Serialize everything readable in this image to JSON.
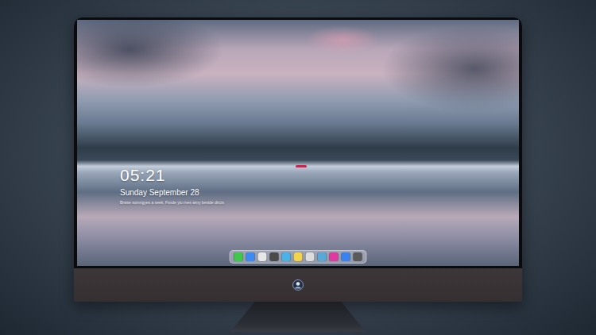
{
  "lock_screen": {
    "time": "05:21",
    "date": "Sunday September 28",
    "note": "Brwse somngyes a seek. Fsnde yiu rnes wmy beside dircts"
  },
  "dock": {
    "items": [
      {
        "color": "#3fc94a"
      },
      {
        "color": "#3d8bf2"
      },
      {
        "color": "#e6e6e6"
      },
      {
        "color": "#4a4a4a"
      },
      {
        "color": "#4ab2e8"
      },
      {
        "color": "#f2d44c"
      },
      {
        "color": "#dcdcdc"
      },
      {
        "color": "#5aa8d8"
      },
      {
        "color": "#e03aa0"
      },
      {
        "color": "#3a82f0"
      },
      {
        "color": "#5a5a5a"
      }
    ]
  }
}
